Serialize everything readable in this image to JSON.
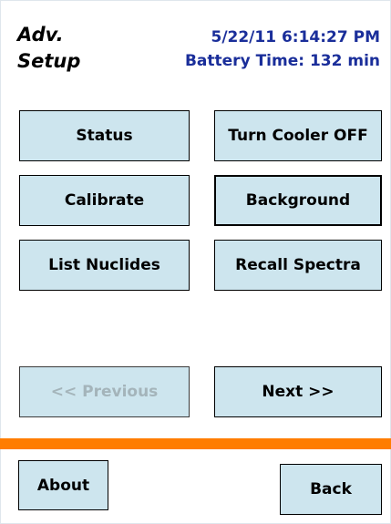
{
  "header": {
    "title_line1": "Adv.",
    "title_line2": "Setup",
    "datetime": "5/22/11 6:14:27 PM",
    "battery": "Battery Time: 132 min"
  },
  "buttons": {
    "status": "Status",
    "turn_cooler_off": "Turn Cooler OFF",
    "calibrate": "Calibrate",
    "background": "Background",
    "list_nuclides": "List Nuclides",
    "recall_spectra": "Recall Spectra",
    "previous": "<< Previous",
    "next": "Next >>",
    "about": "About",
    "back": "Back"
  },
  "colors": {
    "button_bg": "#cde5ee",
    "header_text": "#1a2e9a",
    "divider": "#ff7d00",
    "disabled_text": "#a4b4ba"
  }
}
